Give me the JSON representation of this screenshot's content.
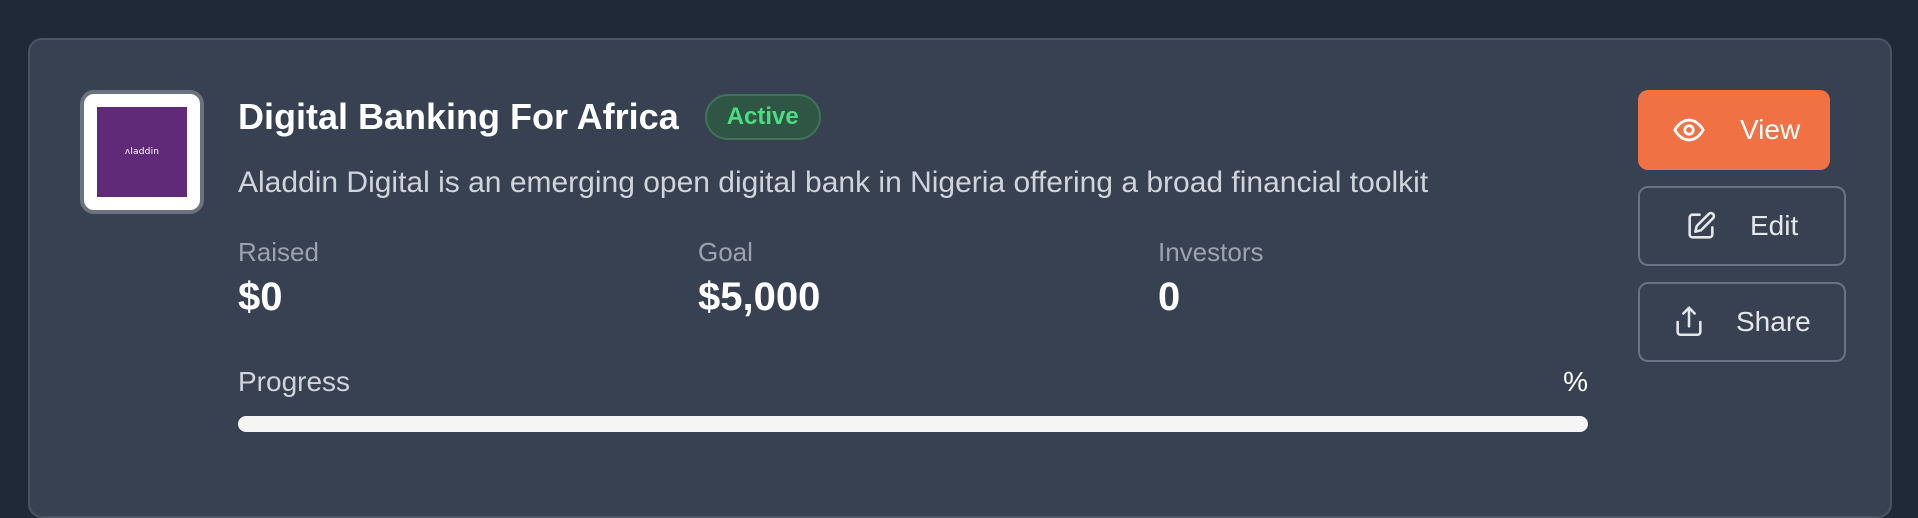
{
  "campaign": {
    "title": "Digital Banking For Africa",
    "status": "Active",
    "description": "Aladdin Digital is an emerging open digital bank in Nigeria offering a broad financial toolkit",
    "logo_text": "ʌladdin",
    "logo_color": "#612a79"
  },
  "stats": {
    "raised_label": "Raised",
    "raised_value": "$0",
    "goal_label": "Goal",
    "goal_value": "$5,000",
    "investors_label": "Investors",
    "investors_value": "0"
  },
  "progress": {
    "label": "Progress",
    "percent_text": "%",
    "fraction": 0
  },
  "actions": {
    "view_label": "View",
    "view_icon": "eye-icon",
    "edit_label": "Edit",
    "edit_icon": "pencil-square-icon",
    "share_label": "Share",
    "share_icon": "share-upload-icon"
  },
  "colors": {
    "accent": "#ef7144",
    "active_badge": "#4ade80",
    "card_background": "#374151",
    "page_background": "#1f2937"
  }
}
